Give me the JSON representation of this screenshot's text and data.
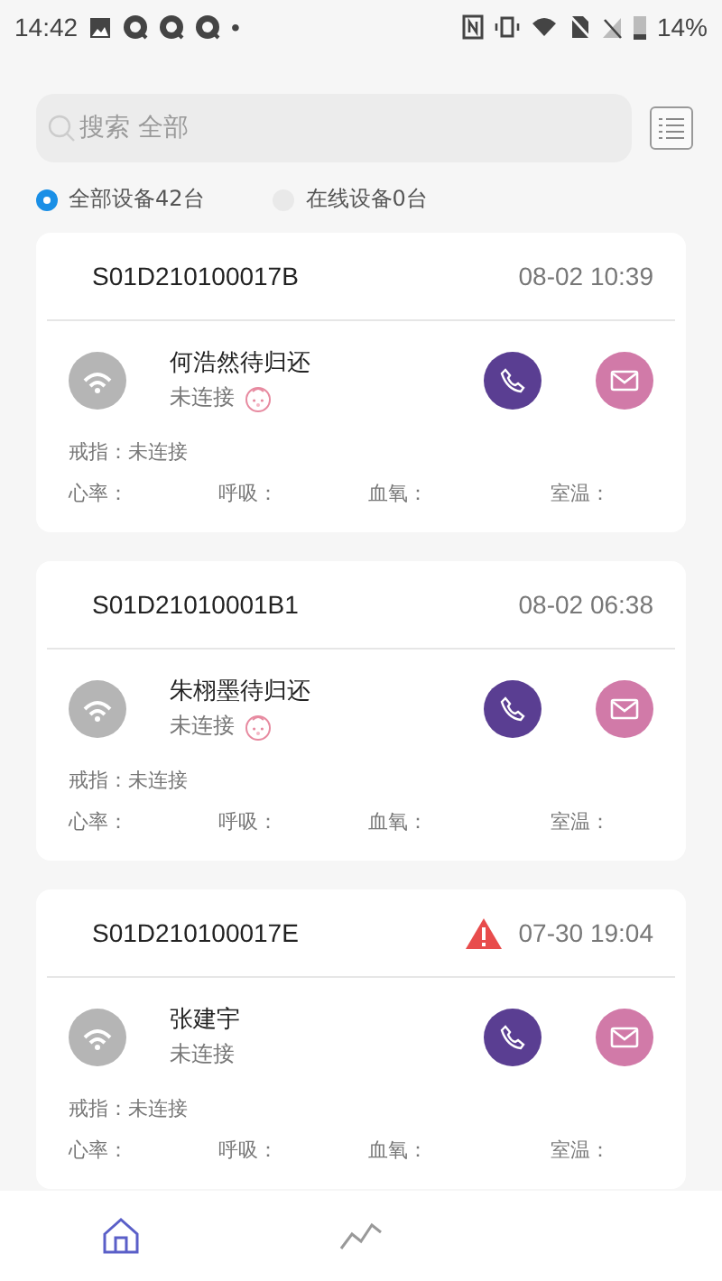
{
  "status_bar": {
    "time": "14:42",
    "dot": "•",
    "battery": "14%"
  },
  "search": {
    "placeholder": "搜索 全部"
  },
  "filters": [
    {
      "label": "全部设备42台",
      "selected": true
    },
    {
      "label": "在线设备0台",
      "selected": false
    }
  ],
  "devices": [
    {
      "id": "S01D210100017B",
      "alert": false,
      "time": "08-02 10:39",
      "name": "何浩然待归还",
      "status": "未连接",
      "baby": true,
      "ring": "戒指：未连接",
      "vitals": [
        "心率：",
        "呼吸：",
        "血氧：",
        "室温："
      ]
    },
    {
      "id": "S01D21010001B1",
      "alert": false,
      "time": "08-02 06:38",
      "name": "朱栩墨待归还",
      "status": "未连接",
      "baby": true,
      "ring": "戒指：未连接",
      "vitals": [
        "心率：",
        "呼吸：",
        "血氧：",
        "室温："
      ]
    },
    {
      "id": "S01D210100017E",
      "alert": true,
      "time": "07-30 19:04",
      "name": "张建宇",
      "status": "未连接",
      "baby": false,
      "ring": "戒指：未连接",
      "vitals": [
        "心率：",
        "呼吸：",
        "血氧：",
        "室温："
      ]
    }
  ],
  "nav": [
    {
      "kind": "home",
      "selected": true
    },
    {
      "kind": "chart",
      "selected": false
    }
  ]
}
